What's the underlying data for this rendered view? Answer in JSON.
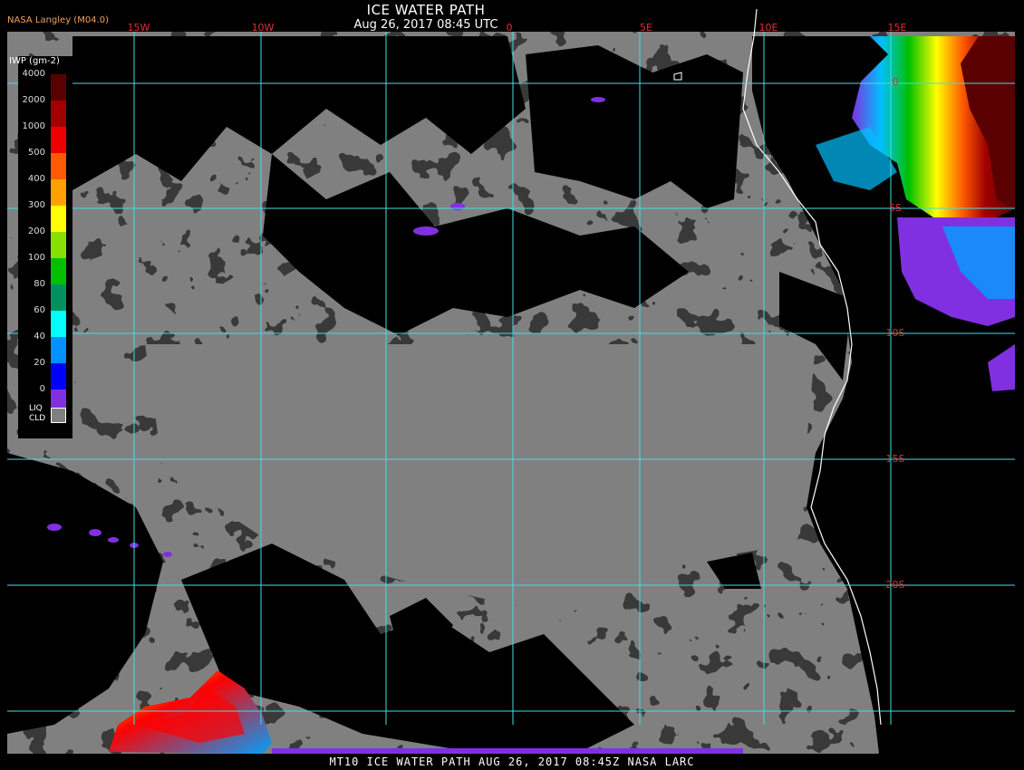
{
  "header": {
    "producer": "NASA Langley (M04.0)",
    "title": "ICE WATER PATH",
    "subtitle": "Aug 26, 2017 08:45 UTC"
  },
  "footer": "MT10  ICE WATER PATH  AUG 26, 2017 08:45Z  NASA LARC",
  "legend": {
    "title": "IWP (gm-2)",
    "levels": [
      {
        "label": "4000",
        "color": "#5a0000"
      },
      {
        "label": "2000",
        "color": "#a00000"
      },
      {
        "label": "1000",
        "color": "#ee0000"
      },
      {
        "label": "500",
        "color": "#ff5a00"
      },
      {
        "label": "400",
        "color": "#ffa000"
      },
      {
        "label": "300",
        "color": "#ffff00"
      },
      {
        "label": "200",
        "color": "#88e000"
      },
      {
        "label": "100",
        "color": "#00c000"
      },
      {
        "label": "80",
        "color": "#009060"
      },
      {
        "label": "60",
        "color": "#00ffff"
      },
      {
        "label": "40",
        "color": "#0090ff"
      },
      {
        "label": "20",
        "color": "#0000ff"
      },
      {
        "label": "0",
        "color": "#8030e0"
      }
    ],
    "liq_label": "LIQ\nCLD",
    "liq_color": "#808080"
  },
  "grid": {
    "color": "#40e0e0",
    "label_color": "#e03030",
    "lon_labels": [
      "15W",
      "10W",
      "0",
      "5E",
      "10E",
      "15E"
    ],
    "lat_labels": [
      "0",
      "5S",
      "10S",
      "15S",
      "20S"
    ]
  },
  "colors": {
    "liquid_cloud": "#808080",
    "clear": "#000000",
    "coastline": "#ffffff"
  }
}
